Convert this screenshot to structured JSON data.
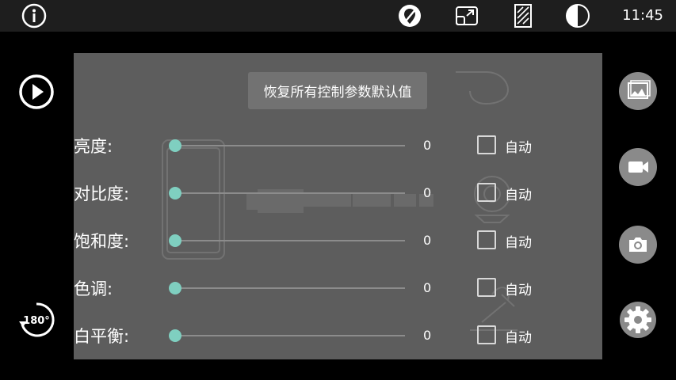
{
  "status_bar": {
    "clock": "11:45",
    "icons": [
      "info-icon",
      "no-location-icon",
      "resize-window-icon",
      "screen-pattern-icon",
      "contrast-icon"
    ]
  },
  "left_controls": {
    "play_icon": "play-icon",
    "rotate_label": "180°"
  },
  "right_controls": [
    "gallery-icon",
    "video-camera-icon",
    "camera-icon",
    "settings-icon"
  ],
  "panel": {
    "reset_label": "恢复所有控制参数默认值",
    "rows": [
      {
        "label": "亮度:",
        "value": "0",
        "auto_label": "自动",
        "auto_checked": false
      },
      {
        "label": "对比度:",
        "value": "0",
        "auto_label": "自动",
        "auto_checked": false
      },
      {
        "label": "饱和度:",
        "value": "0",
        "auto_label": "自动",
        "auto_checked": false
      },
      {
        "label": "色调:",
        "value": "0",
        "auto_label": "自动",
        "auto_checked": false
      },
      {
        "label": "白平衡:",
        "value": "0",
        "auto_label": "自动",
        "auto_checked": false
      }
    ]
  },
  "colors": {
    "accent": "#7fcfc0",
    "panel_bg": "#5d5d5d",
    "status_bar_bg": "#1e1e1e",
    "button_bg": "#8a8a8a"
  }
}
